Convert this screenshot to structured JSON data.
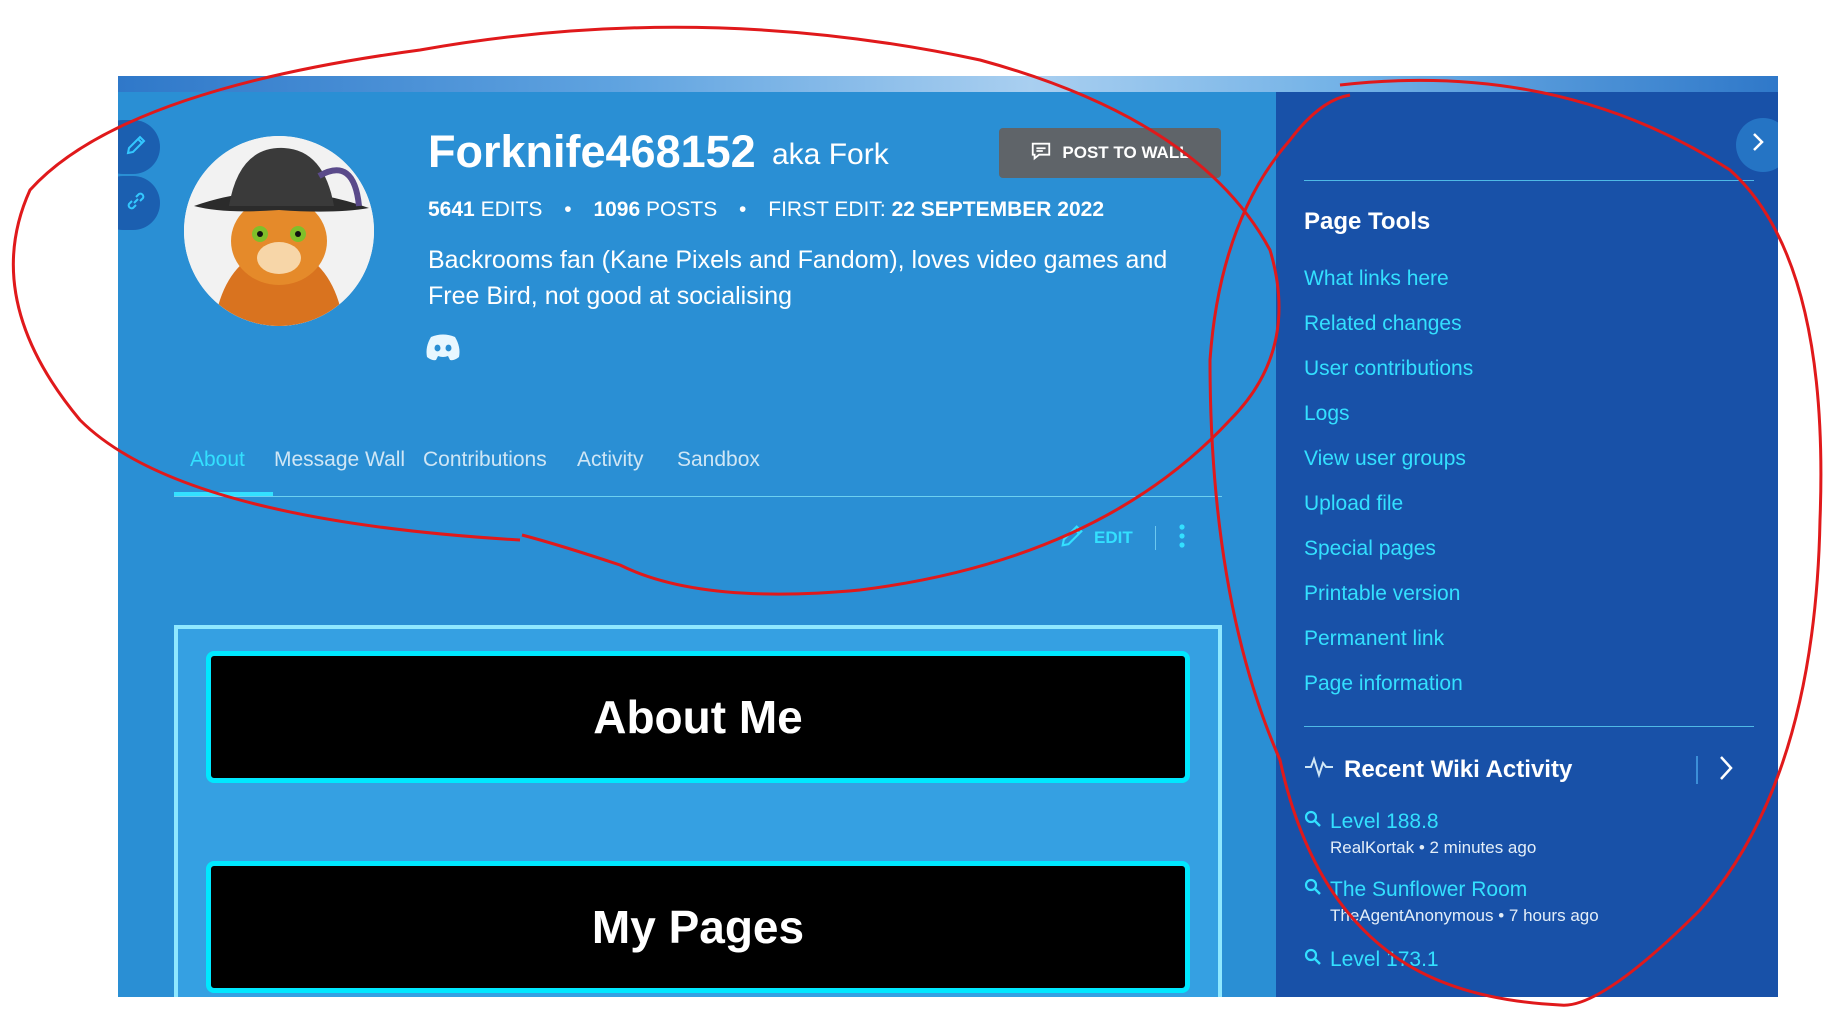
{
  "profile": {
    "username": "Forknife468152",
    "aka": "aka Fork",
    "post_button": "POST TO WALL",
    "edits_count": "5641",
    "edits_label": "EDITS",
    "posts_count": "1096",
    "posts_label": "POSTS",
    "first_edit_label": "FIRST EDIT:",
    "first_edit_date": "22 SEPTEMBER 2022",
    "bio": "Backrooms fan (Kane Pixels and Fandom), loves video games and Free Bird, not good at socialising",
    "stat_separator": "•"
  },
  "tabs": [
    "About",
    "Message Wall",
    "Contributions",
    "Activity",
    "Sandbox"
  ],
  "active_tab": "About",
  "toolbar": {
    "edit_label": "EDIT"
  },
  "content": {
    "headings": [
      "About Me",
      "My Pages"
    ]
  },
  "rail": {
    "page_tools_title": "Page Tools",
    "page_tools": [
      "What links here",
      "Related changes",
      "User contributions",
      "Logs",
      "View user groups",
      "Upload file",
      "Special pages",
      "Printable version",
      "Permanent link",
      "Page information"
    ],
    "recent_activity_title": "Recent Wiki Activity",
    "recent_activity": [
      {
        "page": "Level 188.8",
        "meta": "RealKortak • 2 minutes ago"
      },
      {
        "page": "The Sunflower Room",
        "meta": "TheAgentAnonymous • 7 hours ago"
      },
      {
        "page": "Level 173.1",
        "meta": ""
      }
    ]
  },
  "icons": {
    "edit": "pencil-icon",
    "link": "link-icon",
    "post": "speech-bubble-icon",
    "discord": "discord-icon",
    "activity": "pulse-icon",
    "search": "search-icon",
    "chevron": "chevron-right-icon",
    "more": "kebab-menu-icon"
  },
  "colors": {
    "main_bg": "#2a8fd4",
    "rail_bg": "#1851a8",
    "accent": "#33e0ff",
    "heading_box": "#000000",
    "annotation": "#e0191b"
  }
}
